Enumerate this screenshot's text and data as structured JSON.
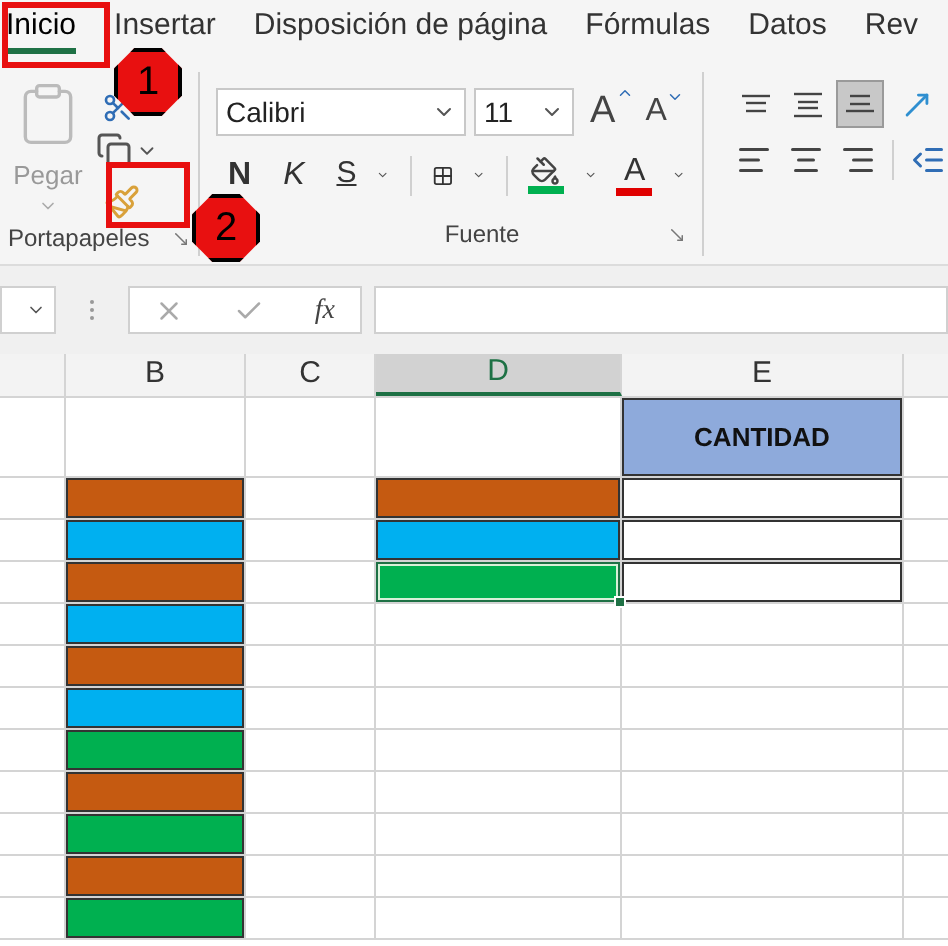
{
  "tabs": [
    {
      "label": "Inicio",
      "selected": true
    },
    {
      "label": "Insertar",
      "selected": false
    },
    {
      "label": "Disposición de página",
      "selected": false
    },
    {
      "label": "Fórmulas",
      "selected": false
    },
    {
      "label": "Datos",
      "selected": false
    },
    {
      "label": "Rev",
      "selected": false
    }
  ],
  "clipboard": {
    "paste_label": "Pegar",
    "group_label": "Portapapeles"
  },
  "font": {
    "font_name": "Calibri",
    "font_size": "11",
    "grow": "A",
    "shrink": "A",
    "bold": "N",
    "italic": "K",
    "underline": "S",
    "font_color": "A",
    "group_label": "Fuente"
  },
  "alignment": {
    "top": {
      "selected": false
    },
    "middle": {
      "selected": false
    },
    "bottom": {
      "selected": true
    }
  },
  "callouts": [
    "1",
    "2"
  ],
  "formula_bar": {
    "fx": "fx"
  },
  "columns": [
    {
      "label": "B",
      "selected": false
    },
    {
      "label": "C",
      "selected": false
    },
    {
      "label": "D",
      "selected": true
    },
    {
      "label": "E",
      "selected": false
    }
  ],
  "rows": [
    {
      "cells": [
        {
          "bordered": false,
          "selected": false
        },
        {
          "bordered": false,
          "selected": false
        },
        {
          "bordered": false,
          "selected": false
        },
        {
          "text": "CANTIDAD",
          "color": "#8eaadb",
          "bordered": true,
          "selected": false
        }
      ]
    },
    {
      "cells": [
        {
          "color": "#c55a11",
          "bordered": true,
          "selected": false
        },
        {
          "bordered": false,
          "selected": false
        },
        {
          "color": "#c55a11",
          "bordered": true,
          "selected": false
        },
        {
          "bordered": true,
          "selected": false
        }
      ]
    },
    {
      "cells": [
        {
          "color": "#00b0f0",
          "bordered": true,
          "selected": false
        },
        {
          "bordered": false,
          "selected": false
        },
        {
          "color": "#00b0f0",
          "bordered": true,
          "selected": false
        },
        {
          "bordered": true,
          "selected": false
        }
      ]
    },
    {
      "cells": [
        {
          "color": "#c55a11",
          "bordered": true,
          "selected": false
        },
        {
          "bordered": false,
          "selected": false
        },
        {
          "color": "#00b050",
          "bordered": true,
          "selected": true
        },
        {
          "bordered": true,
          "selected": false
        }
      ]
    },
    {
      "cells": [
        {
          "color": "#00b0f0",
          "bordered": true,
          "selected": false
        },
        {
          "bordered": false,
          "selected": false
        },
        {
          "bordered": false,
          "selected": false
        },
        {
          "bordered": false,
          "selected": false
        }
      ]
    },
    {
      "cells": [
        {
          "color": "#c55a11",
          "bordered": true,
          "selected": false
        },
        {
          "bordered": false,
          "selected": false
        },
        {
          "bordered": false,
          "selected": false
        },
        {
          "bordered": false,
          "selected": false
        }
      ]
    },
    {
      "cells": [
        {
          "color": "#00b0f0",
          "bordered": true,
          "selected": false
        },
        {
          "bordered": false,
          "selected": false
        },
        {
          "bordered": false,
          "selected": false
        },
        {
          "bordered": false,
          "selected": false
        }
      ]
    },
    {
      "cells": [
        {
          "color": "#00b050",
          "bordered": true,
          "selected": false
        },
        {
          "bordered": false,
          "selected": false
        },
        {
          "bordered": false,
          "selected": false
        },
        {
          "bordered": false,
          "selected": false
        }
      ]
    },
    {
      "cells": [
        {
          "color": "#c55a11",
          "bordered": true,
          "selected": false
        },
        {
          "bordered": false,
          "selected": false
        },
        {
          "bordered": false,
          "selected": false
        },
        {
          "bordered": false,
          "selected": false
        }
      ]
    },
    {
      "cells": [
        {
          "color": "#00b050",
          "bordered": true,
          "selected": false
        },
        {
          "bordered": false,
          "selected": false
        },
        {
          "bordered": false,
          "selected": false
        },
        {
          "bordered": false,
          "selected": false
        }
      ]
    },
    {
      "cells": [
        {
          "color": "#c55a11",
          "bordered": true,
          "selected": false
        },
        {
          "bordered": false,
          "selected": false
        },
        {
          "bordered": false,
          "selected": false
        },
        {
          "bordered": false,
          "selected": false
        }
      ]
    },
    {
      "cells": [
        {
          "color": "#00b050",
          "bordered": true,
          "selected": false
        },
        {
          "bordered": false,
          "selected": false
        },
        {
          "bordered": false,
          "selected": false
        },
        {
          "bordered": false,
          "selected": false
        }
      ]
    }
  ]
}
